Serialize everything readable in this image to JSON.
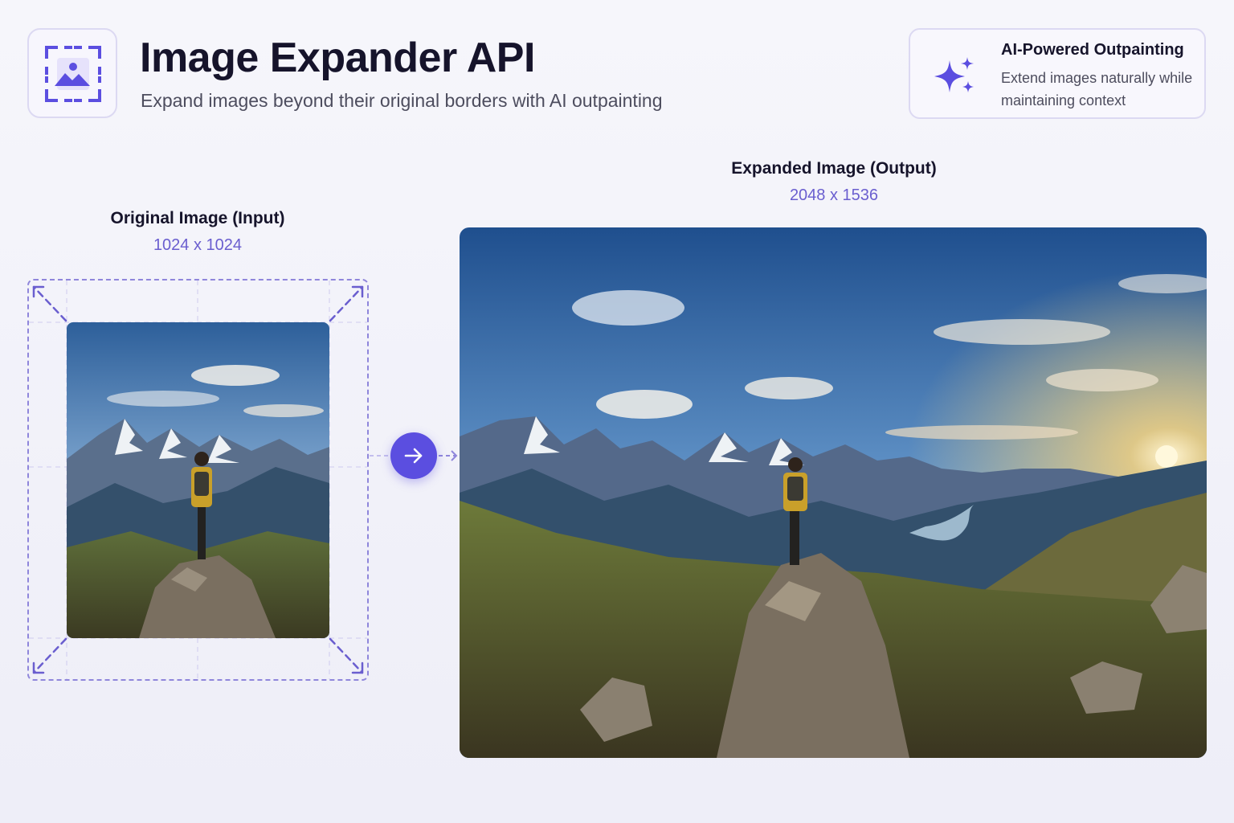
{
  "header": {
    "logo_icon": "image-expand-icon",
    "title": "Image Expander API",
    "subtitle": "Expand images beyond their original borders with AI outpainting"
  },
  "feature": {
    "icon": "sparkle-icon",
    "title": "AI-Powered Outpainting",
    "description": "Extend images naturally while maintaining context"
  },
  "input": {
    "label": "Original Image (Input)",
    "dimensions": "1024 x 1024"
  },
  "output": {
    "label": "Expanded Image (Output)",
    "dimensions": "2048 x 1536"
  },
  "transform": {
    "icon": "arrow-right-icon"
  },
  "colors": {
    "accent": "#5b4ee0",
    "accent_light": "#8f86db",
    "title": "#16142b",
    "text_muted": "#4d4d5e",
    "dims": "#6a5ecf"
  }
}
